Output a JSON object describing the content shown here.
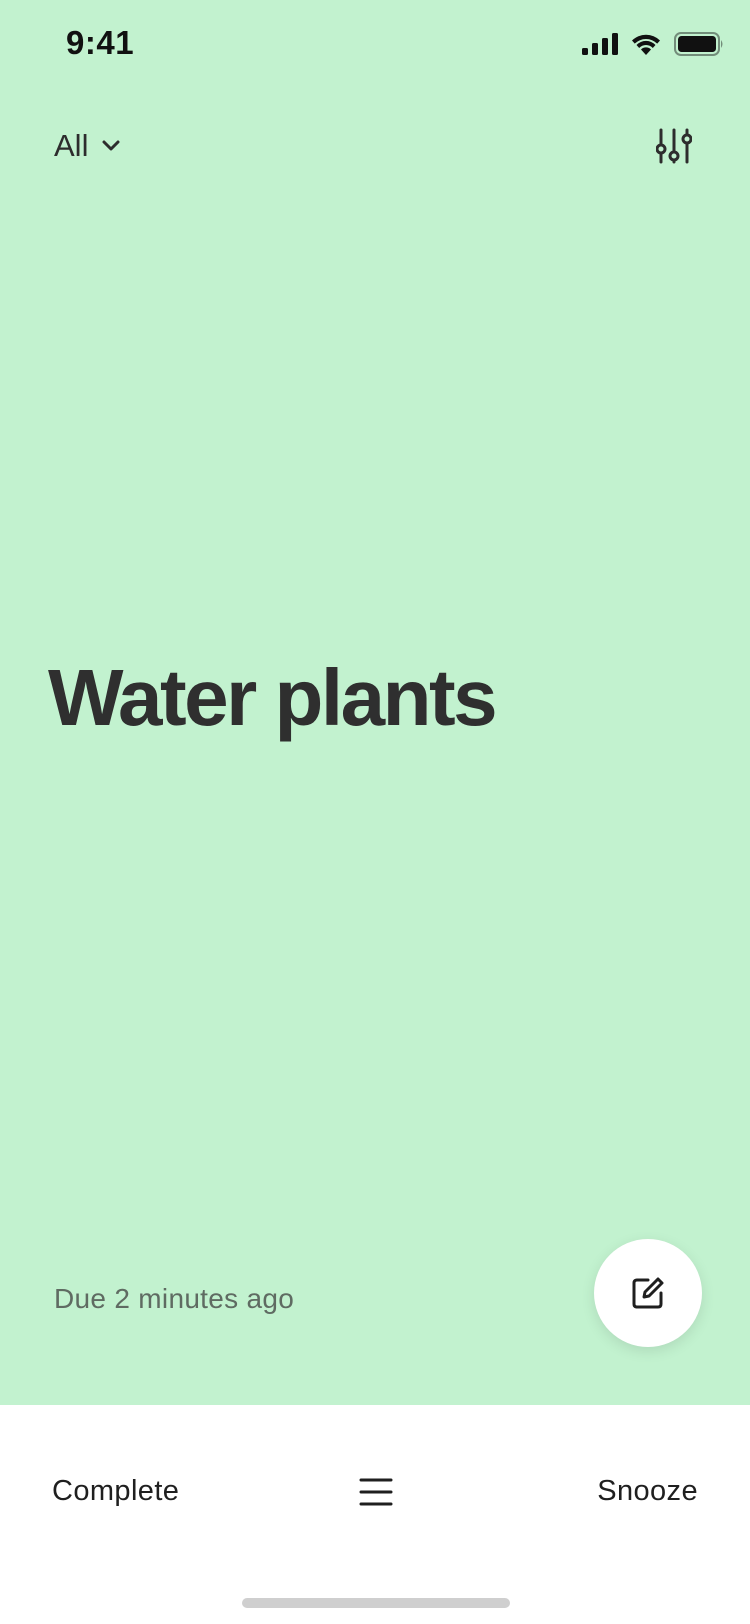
{
  "status_bar": {
    "time": "9:41"
  },
  "header": {
    "filter_label": "All",
    "filter_icon": "chevron-down-icon",
    "settings_icon": "sliders-icon"
  },
  "task": {
    "title": "Water plants",
    "due_text": "Due 2 minutes ago"
  },
  "fab": {
    "icon": "edit-icon"
  },
  "action_bar": {
    "complete_label": "Complete",
    "menu_icon": "menu-icon",
    "snooze_label": "Snooze"
  },
  "colors": {
    "card_background": "#c2f2cf",
    "text_primary": "#2f2f2f",
    "text_secondary": "#5f6b62",
    "action_bar_background": "#ffffff"
  }
}
